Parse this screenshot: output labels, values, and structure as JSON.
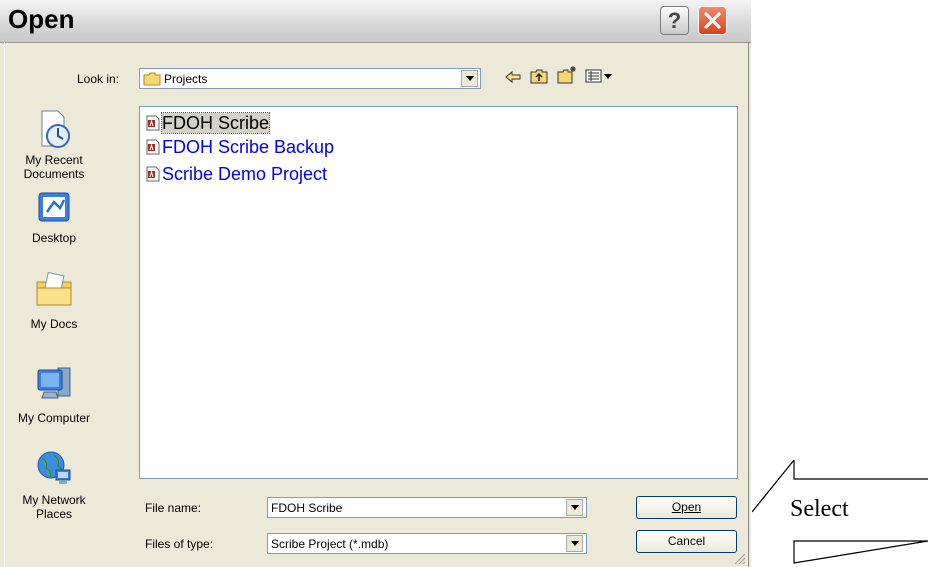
{
  "window": {
    "title": "Open",
    "help_label": "?",
    "close_label": "X"
  },
  "lookin": {
    "label": "Look in:",
    "value": "Projects"
  },
  "toolbar": {
    "back_icon": "back-arrow-icon",
    "up_icon": "up-folder-icon",
    "new_folder_icon": "new-folder-icon",
    "views_icon": "views-menu-icon"
  },
  "places": [
    {
      "label": "My Recent Documents",
      "icon": "recent-documents-icon"
    },
    {
      "label": "Desktop",
      "icon": "desktop-icon"
    },
    {
      "label": "My Docs",
      "icon": "my-docs-icon"
    },
    {
      "label": "My Computer",
      "icon": "my-computer-icon"
    },
    {
      "label": "My Network Places",
      "icon": "network-places-icon"
    }
  ],
  "files": [
    {
      "name": "FDOH Scribe",
      "selected": true
    },
    {
      "name": "FDOH Scribe Backup",
      "selected": false
    },
    {
      "name": "Scribe Demo Project",
      "selected": false
    }
  ],
  "filename": {
    "label": "File name:",
    "value": "FDOH Scribe"
  },
  "filetype": {
    "label": "Files of type:",
    "value": "Scribe Project (*.mdb)"
  },
  "buttons": {
    "open": "Open",
    "cancel": "Cancel"
  },
  "annotation": {
    "text": "Select"
  },
  "colors": {
    "file_link": "#0000ee",
    "close_button": "#d6431d",
    "dialog_bg": "#ece9d8"
  }
}
